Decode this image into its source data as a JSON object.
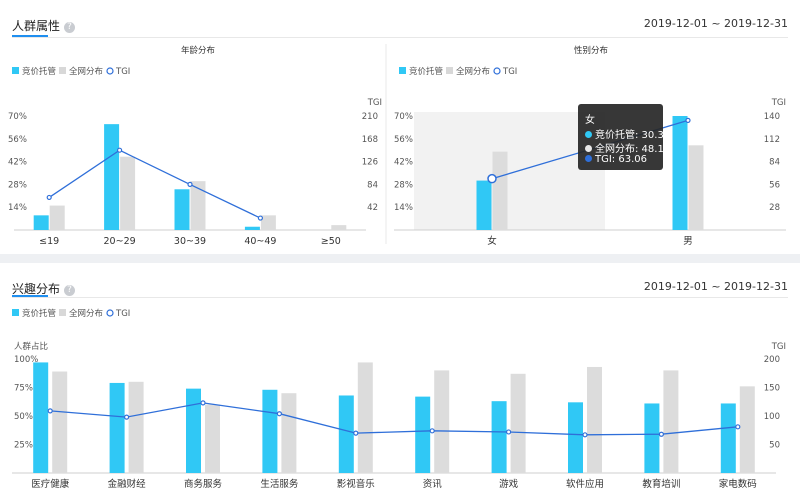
{
  "colors": {
    "bid": "#30c8f5",
    "all": "#dcdcdc",
    "tgi": "#2f6fd9",
    "accent": "#1f8ff0"
  },
  "legend": {
    "bid": "竞价托管",
    "all": "全网分布",
    "tgi": "TGI"
  },
  "crowd": {
    "title": "人群属性",
    "help": "?",
    "date_range": "2019-12-01 ~ 2019-12-31"
  },
  "interest": {
    "title": "兴趣分布",
    "help": "?",
    "date_range": "2019-12-01 ~ 2019-12-31"
  },
  "chart_data": [
    {
      "type": "bar",
      "title": "年龄分布",
      "categories": [
        "≤19",
        "20~29",
        "30~39",
        "40~49",
        "≥50"
      ],
      "series": [
        {
          "name": "竞价托管",
          "values": [
            9,
            65,
            25,
            2,
            0
          ]
        },
        {
          "name": "全网分布",
          "values": [
            15,
            45,
            30,
            9,
            3
          ]
        },
        {
          "name": "TGI",
          "values": [
            60,
            147,
            84,
            22,
            0
          ],
          "axis": "right"
        }
      ],
      "ylim": [
        0,
        70
      ],
      "y2lim": [
        0,
        210
      ],
      "y_ticks": [
        "14%",
        "28%",
        "42%",
        "56%",
        "70%"
      ],
      "y2_ticks": [
        "42",
        "84",
        "126",
        "168",
        "210"
      ],
      "y2label": "TGI"
    },
    {
      "type": "bar",
      "title": "性别分布",
      "categories": [
        "女",
        "男"
      ],
      "series": [
        {
          "name": "竞价托管",
          "values": [
            30.34,
            70
          ]
        },
        {
          "name": "全网分布",
          "values": [
            48.12,
            52
          ]
        },
        {
          "name": "TGI",
          "values": [
            63.06,
            134.6
          ],
          "axis": "right"
        }
      ],
      "ylim": [
        0,
        70
      ],
      "y2lim": [
        0,
        140
      ],
      "y_ticks": [
        "14%",
        "28%",
        "42%",
        "56%",
        "70%"
      ],
      "y2_ticks": [
        "28",
        "56",
        "84",
        "112",
        "140"
      ],
      "y2label": "TGI",
      "tooltip": {
        "title": "女",
        "rows": [
          "竞价托管: 30.34",
          "全网分布: 48.12",
          "TGI: 63.06"
        ]
      }
    },
    {
      "type": "bar",
      "categories": [
        "医疗健康",
        "金融财经",
        "商务服务",
        "生活服务",
        "影视音乐",
        "资讯",
        "游戏",
        "软件应用",
        "教育培训",
        "家电数码"
      ],
      "series": [
        {
          "name": "竞价托管",
          "values": [
            97,
            79,
            74,
            73,
            68,
            67,
            63,
            62,
            61,
            61
          ]
        },
        {
          "name": "全网分布",
          "values": [
            89,
            80,
            60,
            70,
            97,
            90,
            87,
            93,
            90,
            76
          ]
        },
        {
          "name": "TGI",
          "values": [
            109,
            98,
            123,
            104,
            70,
            74,
            72,
            67,
            68,
            81
          ],
          "axis": "right"
        }
      ],
      "ylim": [
        0,
        100
      ],
      "y2lim": [
        0,
        200
      ],
      "y_ticks": [
        "25%",
        "50%",
        "75%",
        "100%"
      ],
      "y2_ticks": [
        "50",
        "100",
        "150",
        "200"
      ],
      "ylabel": "人群占比",
      "y2label": "TGI"
    }
  ]
}
